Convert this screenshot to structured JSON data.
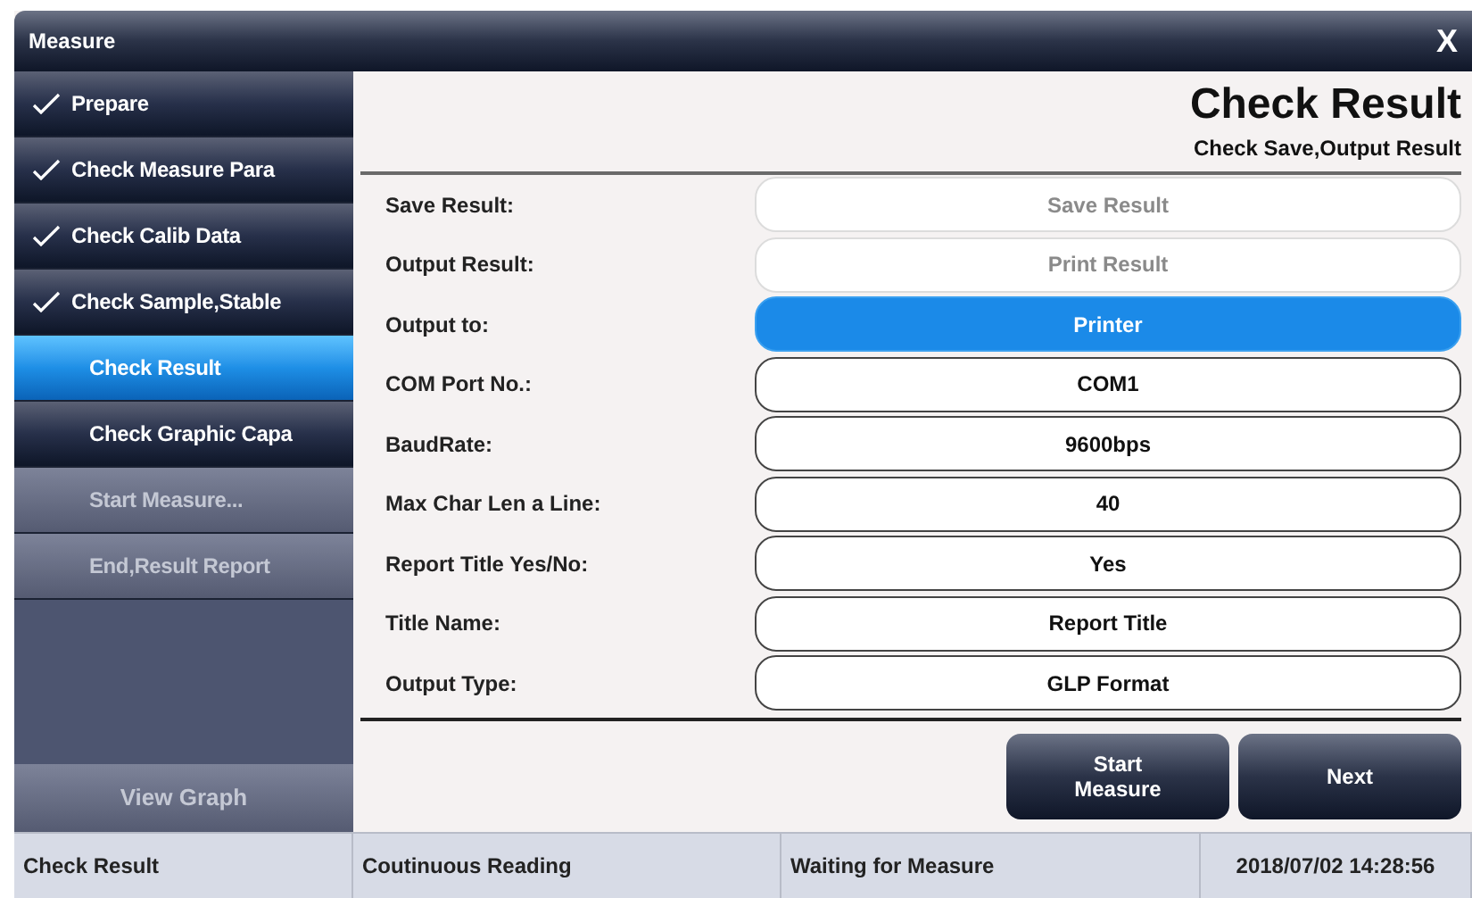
{
  "window": {
    "title": "Measure",
    "close": "X"
  },
  "sidebar": {
    "items": [
      {
        "label": "Prepare",
        "done": true,
        "selected": false,
        "disabled": false
      },
      {
        "label": "Check Measure Para",
        "done": true,
        "selected": false,
        "disabled": false
      },
      {
        "label": "Check Calib Data",
        "done": true,
        "selected": false,
        "disabled": false
      },
      {
        "label": "Check Sample,Stable",
        "done": true,
        "selected": false,
        "disabled": false
      },
      {
        "label": "Check Result",
        "done": false,
        "selected": true,
        "disabled": false
      },
      {
        "label": "Check Graphic Capa",
        "done": false,
        "selected": false,
        "disabled": false
      },
      {
        "label": "Start Measure...",
        "done": false,
        "selected": false,
        "disabled": true
      },
      {
        "label": "End,Result Report",
        "done": false,
        "selected": false,
        "disabled": true
      }
    ],
    "bottom_button": {
      "label": "View Graph",
      "disabled": true
    }
  },
  "header": {
    "title": "Check Result",
    "subtitle": "Check Save,Output Result"
  },
  "settings": [
    {
      "label": "Save Result:",
      "value": "Save Result",
      "disabled": true,
      "selected": false
    },
    {
      "label": "Output Result:",
      "value": "Print Result",
      "disabled": true,
      "selected": false
    },
    {
      "label": "Output to:",
      "value": "Printer",
      "disabled": false,
      "selected": true
    },
    {
      "label": "COM Port No.:",
      "value": "COM1",
      "disabled": false,
      "selected": false
    },
    {
      "label": "BaudRate:",
      "value": "9600bps",
      "disabled": false,
      "selected": false
    },
    {
      "label": "Max Char Len a Line:",
      "value": "40",
      "disabled": false,
      "selected": false
    },
    {
      "label": "Report Title Yes/No:",
      "value": "Yes",
      "disabled": false,
      "selected": false
    },
    {
      "label": "Title Name:",
      "value": "Report Title",
      "disabled": false,
      "selected": false
    },
    {
      "label": "Output Type:",
      "value": "GLP Format",
      "disabled": false,
      "selected": false
    }
  ],
  "buttons": [
    "Start\nMeasure",
    "Next"
  ],
  "status_bar": [
    "Check Result",
    "Coutinuous Reading",
    "Waiting for Measure",
    "2018/07/02 14:28:56"
  ]
}
